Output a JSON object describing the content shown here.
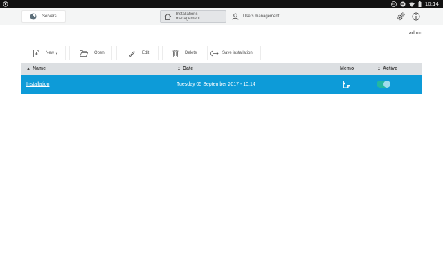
{
  "statusbar": {
    "clock": "10:14"
  },
  "header": {
    "servers_label": "Servers",
    "tabs": [
      {
        "label": "Installations management",
        "active": true
      },
      {
        "label": "Users management",
        "active": false
      }
    ],
    "user": "admin"
  },
  "toolbar": {
    "new_label": "New",
    "open_label": "Open",
    "edit_label": "Edit",
    "delete_label": "Delete",
    "save_label": "Save installation"
  },
  "table": {
    "columns": {
      "name": "Name",
      "date": "Date",
      "memo": "Memo",
      "active": "Active"
    },
    "rows": [
      {
        "name": "Installation",
        "date": "Tuesday 05 September 2017 - 10:14",
        "active": true
      }
    ]
  },
  "colors": {
    "accent": "#0d9bd8",
    "toggle_on": "#23b7a0",
    "header_bg": "#dcdfe2"
  }
}
